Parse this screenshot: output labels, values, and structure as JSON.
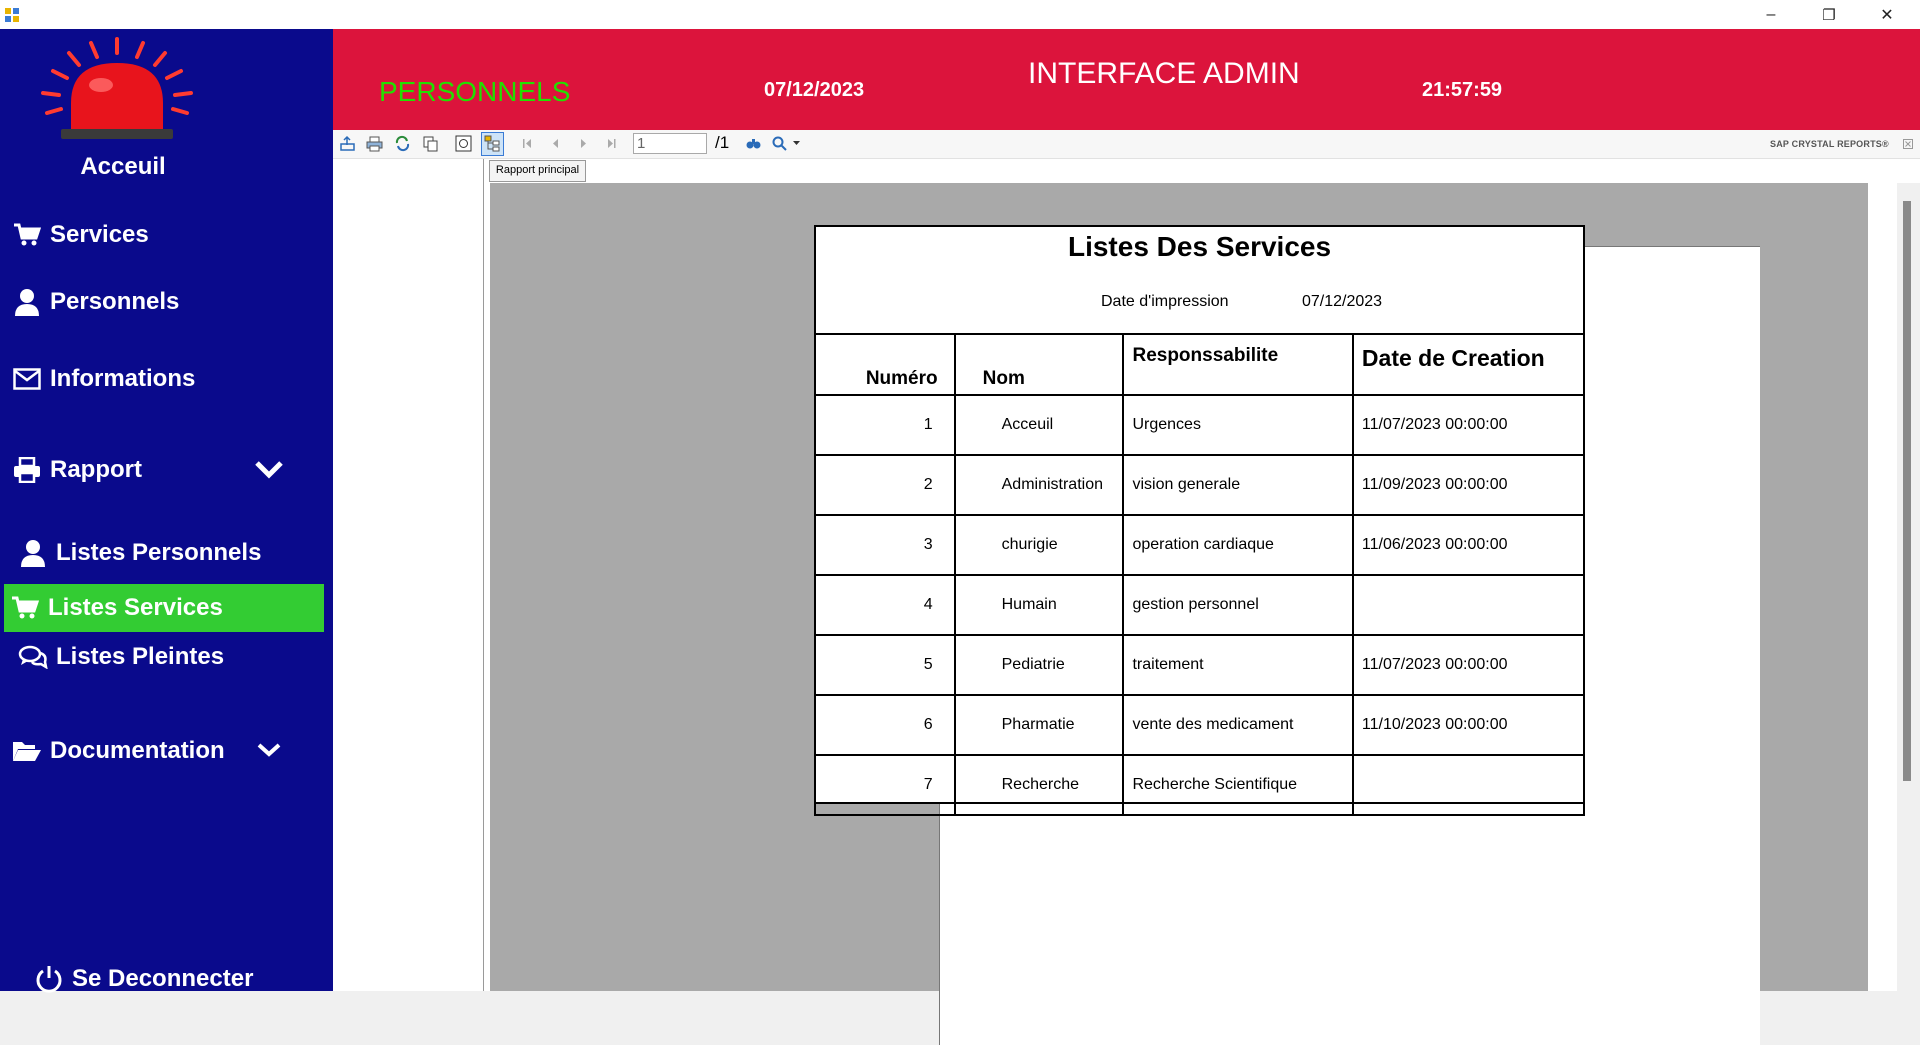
{
  "window": {
    "minimize_glyph": "–",
    "restore_glyph": "❐",
    "close_glyph": "✕"
  },
  "sidebar": {
    "home_label": "Acceuil",
    "items": [
      {
        "label": "Services",
        "icon": "cart-icon"
      },
      {
        "label": "Personnels",
        "icon": "user-icon"
      },
      {
        "label": "Informations",
        "icon": "envelope-icon"
      },
      {
        "label": "Rapport",
        "icon": "printer-icon"
      },
      {
        "label": "Listes Personnels",
        "icon": "user-icon"
      },
      {
        "label": "Listes Services",
        "icon": "cart-icon",
        "active": true
      },
      {
        "label": "Listes Pleintes",
        "icon": "chat-icon"
      },
      {
        "label": "Documentation",
        "icon": "folder-open-icon"
      }
    ],
    "logout_label": "Se Deconnecter",
    "colors": {
      "background": "#0a0a8c",
      "active": "#33cc33"
    }
  },
  "header": {
    "section": "PERSONNELS",
    "date": "07/12/2023",
    "title": "INTERFACE ADMIN",
    "time": "21:57:59",
    "colors": {
      "background": "#dc143c",
      "section": "#22e000"
    }
  },
  "viewer": {
    "page_input": "1",
    "page_total": "/1",
    "brand": "SAP CRYSTAL REPORTS®",
    "tab_label": "Rapport principal"
  },
  "report": {
    "title": "Listes Des Services",
    "print_date_label": "Date d'impression",
    "print_date": "07/12/2023",
    "columns": [
      "Numéro",
      "Nom",
      "Responssabilite",
      "Date de Creation"
    ],
    "rows": [
      [
        "1",
        "Acceuil",
        "Urgences",
        "11/07/2023  00:00:00"
      ],
      [
        "2",
        "Administration",
        "vision generale",
        "11/09/2023  00:00:00"
      ],
      [
        "3",
        "churigie",
        "operation cardiaque",
        "11/06/2023  00:00:00"
      ],
      [
        "4",
        "Humain",
        "gestion personnel",
        ""
      ],
      [
        "5",
        "Pediatrie",
        "traitement",
        "11/07/2023  00:00:00"
      ],
      [
        "6",
        "Pharmatie",
        "vente des medicament",
        "11/10/2023  00:00:00"
      ],
      [
        "7",
        "Recherche",
        "Recherche Scientifique",
        ""
      ]
    ]
  }
}
